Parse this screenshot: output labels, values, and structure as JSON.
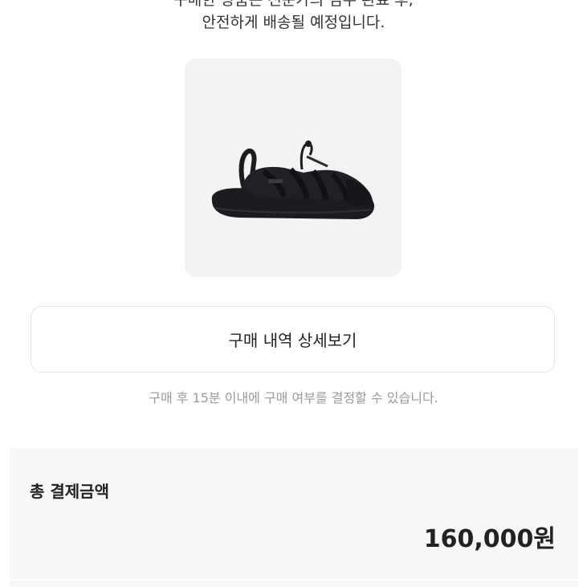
{
  "notice": {
    "line1": "구매한 상품은 전문가의 검수 완료 후,",
    "line2": "안전하게 배송될 예정입니다."
  },
  "product": {
    "image_icon": "black-sandal-image",
    "background_color": "#f3f3f3"
  },
  "actions": {
    "detail_label": "구매 내역 상세보기"
  },
  "hint": "구매 후 15분 이내에 구매 여부를 결정할 수 있습니다.",
  "payment": {
    "total_label": "총 결제금액",
    "total_amount": "160,000원"
  }
}
